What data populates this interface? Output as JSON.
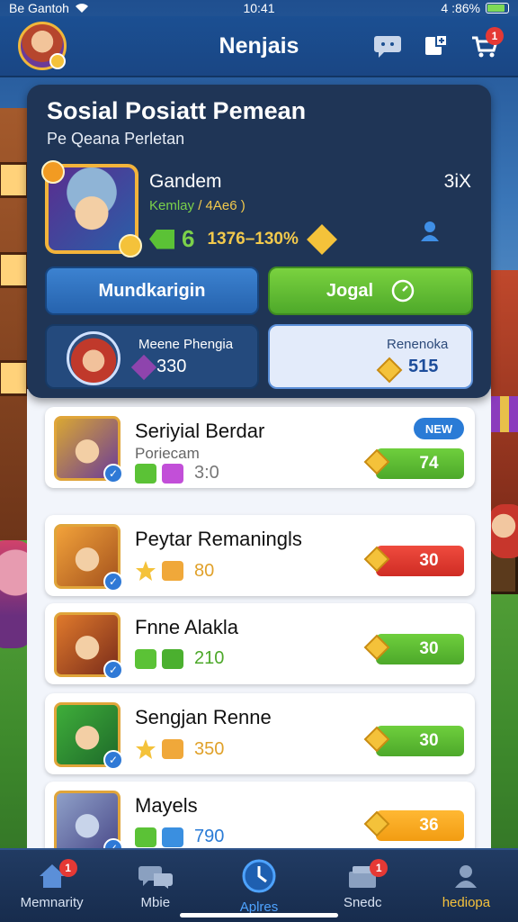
{
  "status_bar": {
    "carrier": "Be Gantoh",
    "time": "10:41",
    "battery": "4 :86%"
  },
  "header": {
    "title": "Nenjais",
    "cart_badge": "1"
  },
  "top_card": {
    "title": "Sosial Posiatt Pemean",
    "subtitle": "Pe Qeana Perletan",
    "hero_name": "Gandem",
    "hero_sub": "Kemlay",
    "hero_sub_paren": "/ 4Ae6 )",
    "hero_count": "3iX",
    "stat_green": "6",
    "stat_range": "1376–130%",
    "btn_left": "Mundkarigin",
    "btn_right": "Jogal",
    "mini_left": {
      "title": "Meene Phengia",
      "value": "330"
    },
    "mini_right": {
      "title": "Renenoka",
      "value": "515"
    }
  },
  "rows": [
    {
      "name": "Seriyial Berdar",
      "sub": "Poriecam",
      "amount": "3:0",
      "price": "74",
      "badge": "NEW",
      "price_color": "green"
    },
    {
      "name": "Peytar Remaningls",
      "amount": "80",
      "price": "30",
      "price_color": "red"
    },
    {
      "name": "Fnne Alakla",
      "amount": "210",
      "price": "30",
      "price_color": "green"
    },
    {
      "name": "Sengjan Renne",
      "amount": "350",
      "price": "30",
      "price_color": "green"
    },
    {
      "name": "Mayels",
      "amount": "790",
      "price": "36",
      "price_color": "orange"
    }
  ],
  "bottom_nav": [
    {
      "label": "Memnarity",
      "icon": "home-icon",
      "badge": "1"
    },
    {
      "label": "Mbie",
      "icon": "chat-icon"
    },
    {
      "label": "Aplres",
      "icon": "clock-icon",
      "active": true
    },
    {
      "label": "Snedc",
      "icon": "shop-icon",
      "badge": "1"
    },
    {
      "label": "hediopa",
      "icon": "person-icon"
    }
  ],
  "colors": {
    "header_blue": "#1b4f92",
    "card_dark": "#1f3556",
    "accent_green": "#5bc236",
    "accent_gold": "#f4c23a",
    "accent_red": "#e53935"
  }
}
